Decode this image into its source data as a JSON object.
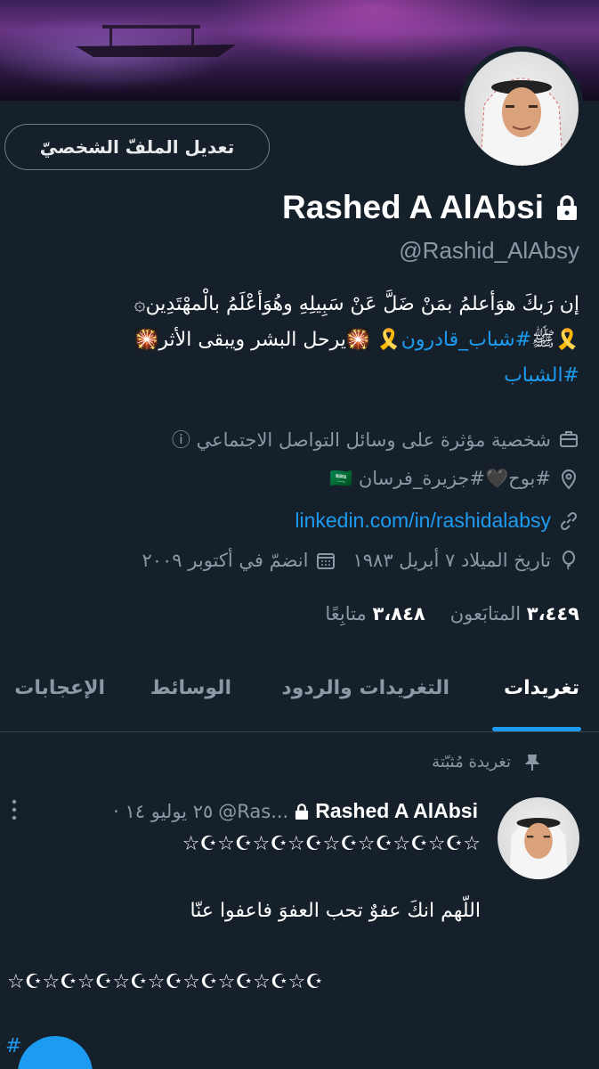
{
  "profile": {
    "name": "Rashed A AlAbsi",
    "handle": "@Rashid_AlAbsy",
    "edit_button": "تعديل الملفّ الشخصيّ",
    "bio_line1": "إن رَبكَ هوَأعلمُ بمَنْ ضَلَّ عَنْ سَبِيلِهِ وهُوَأعْلَمُ بالْمهْتَدِين۞",
    "bio_line2_part1": "🎗️ﷺ",
    "bio_line2_link": "#شباب_قادرون",
    "bio_line2_part2": "🎇يرحل البشر ويبقى الأثر🎇",
    "bio_line3_link": "#الشباب",
    "category": "شخصية مؤثرة على وسائل التواصل الاجتماعي ⓘ",
    "location": "#بوح🖤#جزيرة_فرسان 🇸🇦",
    "website": "linkedin.com/in/rashidalabsy",
    "birth": "تاريخ الميلاد ٧ أبريل ١٩٨٣",
    "joined": "انضمّ في أكتوبر ٢٠٠٩",
    "followers_count": "٣،٤٤٩",
    "followers_label": "المتابَعون",
    "following_count": "٣،٨٤٨",
    "following_label": "متابِعًا"
  },
  "tabs": [
    "تغريدات",
    "التغريدات والردود",
    "الوسائط",
    "الإعجابات"
  ],
  "active_tab": "تغريدات",
  "pinned_label": "تغريدة مُثبّتة",
  "tweet": {
    "name": "Rashed A AlAbsi",
    "handle": "@Ras...",
    "date": "· ٢٥ يوليو ١٤",
    "stars_top": "☆☪☆☪☆☪☆☪☆☪☆☪☆☪☆☪☆",
    "text": "اللّهم انكَ عفوٌ تحب العفوَ فاعفوا عنّا",
    "stars_bottom": "☆☪☆☪☆☪☆☪☆☪☆☪☆☪☆☪☆☪",
    "tag": "#"
  },
  "colors": {
    "background": "#15202b",
    "accent": "#1d9bf0",
    "secondary_text": "#8b98a5"
  }
}
